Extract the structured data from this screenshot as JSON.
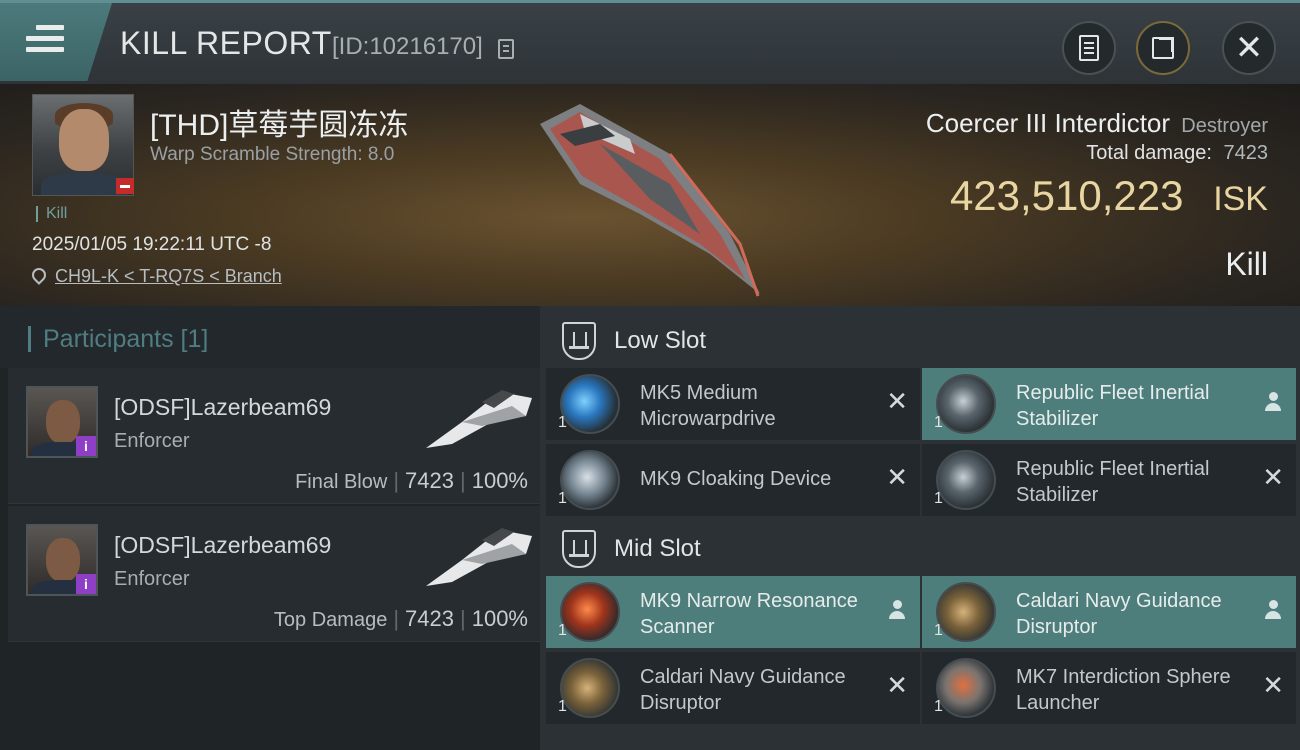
{
  "header": {
    "title": "KILL REPORT",
    "report_id": "[ID:10216170]"
  },
  "victim": {
    "name": "[THD]草莓芋圆冻冻",
    "warp_scramble": "Warp Scramble Strength: 8.0",
    "kill_tag": "Kill",
    "datetime": "2025/01/05 19:22:11 UTC -8",
    "location": "CH9L-K < T-RQ7S < Branch"
  },
  "ship": {
    "name": "Coercer III Interdictor",
    "class": "Destroyer",
    "total_damage_label": "Total damage:",
    "total_damage": "7423",
    "isk_value": "423,510,223",
    "isk_unit": "ISK",
    "result": "Kill"
  },
  "participants": {
    "title": "Participants [1]",
    "rows": [
      {
        "name": "[ODSF]Lazerbeam69",
        "ship": "Enforcer",
        "role": "Final Blow",
        "damage": "7423",
        "percent": "100%"
      },
      {
        "name": "[ODSF]Lazerbeam69",
        "ship": "Enforcer",
        "role": "Top Damage",
        "damage": "7423",
        "percent": "100%"
      }
    ]
  },
  "slots": {
    "low": {
      "title": "Low Slot",
      "modules": [
        {
          "name": "MK5 Medium Microwarpdrive",
          "qty": "1",
          "status": "destroyed"
        },
        {
          "name": "Republic Fleet Inertial Stabilizer",
          "qty": "1",
          "status": "dropped"
        },
        {
          "name": "MK9 Cloaking Device",
          "qty": "1",
          "status": "destroyed"
        },
        {
          "name": "Republic Fleet Inertial Stabilizer",
          "qty": "1",
          "status": "destroyed"
        }
      ]
    },
    "mid": {
      "title": "Mid Slot",
      "modules": [
        {
          "name": "MK9 Narrow Resonance Scanner",
          "qty": "1",
          "status": "dropped"
        },
        {
          "name": "Caldari Navy Guidance Disruptor",
          "qty": "1",
          "status": "dropped"
        },
        {
          "name": "Caldari Navy Guidance Disruptor",
          "qty": "1",
          "status": "destroyed"
        },
        {
          "name": "MK7 Interdiction Sphere Launcher",
          "qty": "1",
          "status": "destroyed"
        }
      ]
    }
  },
  "icons": {
    "menu": "hamburger-menu-icon",
    "copy": "copy-icon",
    "notes": "clipboard-icon",
    "share": "share-icon",
    "close": "close-icon",
    "location": "location-pin-icon",
    "slot": "shield-slot-icon",
    "destroyed": "x-icon",
    "dropped": "person-icon"
  },
  "colors": {
    "accent": "#4e7e7c",
    "isk_gold": "#e8d5a2",
    "title_tab": "#4c7a7c",
    "badge_red": "#c42b2b",
    "badge_purple": "#8e3fc6"
  }
}
